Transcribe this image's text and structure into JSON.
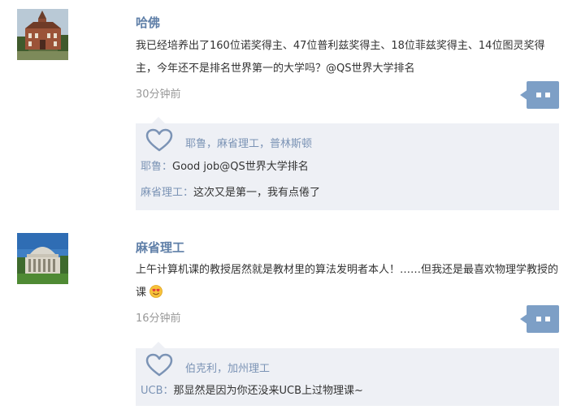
{
  "posts": [
    {
      "author": "哈佛",
      "avatar_icon": "harvard-building-icon",
      "text": "我已经培养出了160位诺奖得主、47位普利兹奖得主、18位菲兹奖得主、14位图灵奖得主，今年还不是排名世界第一的大学吗？@QS世界大学排名",
      "time": "30分钟前",
      "likers": "耶鲁，麻省理工，普林斯顿",
      "replies": [
        {
          "who": "耶鲁",
          "sep": "：",
          "text": "Good job@QS世界大学排名"
        },
        {
          "who": "麻省理工",
          "sep": "：",
          "text": "这次又是第一，我有点倦了"
        }
      ]
    },
    {
      "author": "麻省理工",
      "avatar_icon": "mit-dome-icon",
      "text": "上午计算机课的教授居然就是教材里的算法发明者本人！……但我还是最喜欢物理学教授的课",
      "emoji": "heart-eyes-emoji-icon",
      "time": "16分钟前",
      "likers": "伯克利，加州理工",
      "replies": [
        {
          "who": "UCB",
          "sep": "：",
          "text": "那显然是因为你还没来UCB上过物理课~"
        }
      ]
    }
  ],
  "colors": {
    "author": "#5f7fa8",
    "link": "#7b93b5",
    "reply_bg": "#eef0f5",
    "comment_button": "#7d9fc6"
  }
}
